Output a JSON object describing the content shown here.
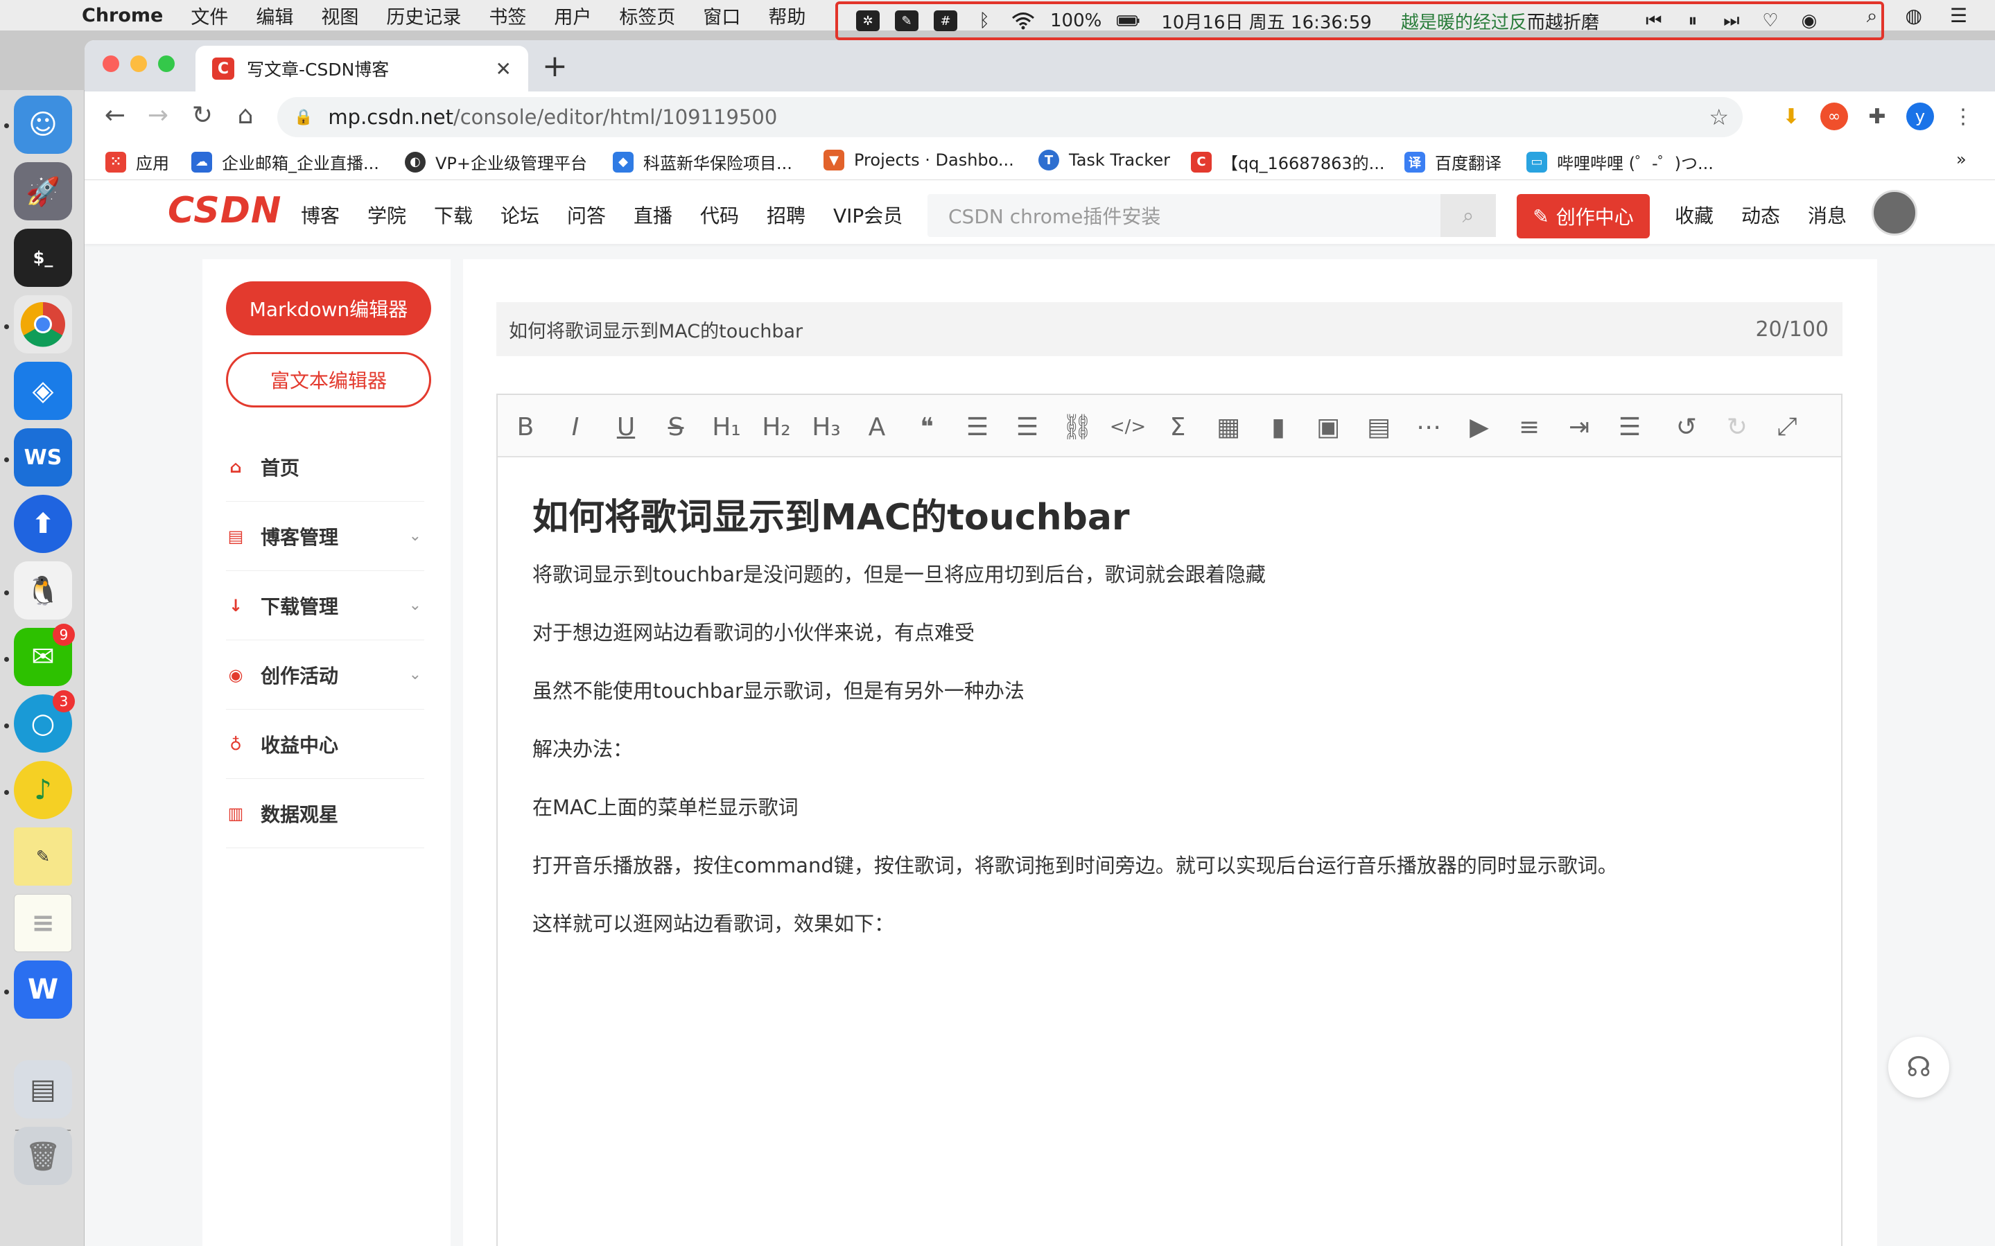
{
  "menubar": {
    "app_name": "Chrome",
    "items": [
      "文件",
      "编辑",
      "视图",
      "历史记录",
      "书签",
      "用户",
      "标签页",
      "窗口",
      "帮助"
    ],
    "battery": "100%",
    "datetime": "10月16日 周五  16:36:59",
    "lyric_highlight": "越是暖的经过反",
    "lyric_rest": "而越折磨"
  },
  "dock": {
    "wechat_badge": "9",
    "chat_badge": "3"
  },
  "browser": {
    "tab_title": "写文章-CSDN博客",
    "url_host": "mp.csdn.net",
    "url_path": "/console/editor/html/109119500",
    "profile_initial": "y",
    "bookmarks": [
      {
        "label": "应用",
        "color": "#e94235"
      },
      {
        "label": "企业邮箱_企业直播...",
        "color": "#2b6bd8"
      },
      {
        "label": "VP+企业级管理平台",
        "color": "#333333"
      },
      {
        "label": "科蓝新华保险项目...",
        "color": "#2f7be4"
      },
      {
        "label": "Projects · Dashbo...",
        "color": "#e2622b"
      },
      {
        "label": "Task Tracker",
        "color": "#2e6fd0"
      },
      {
        "label": "【qq_16687863的...",
        "color": "#e33a2e"
      },
      {
        "label": "百度翻译",
        "color": "#3b7ff3"
      },
      {
        "label": "哔哩哔哩 (゜-゜)つ...",
        "color": "#29a3e0"
      }
    ],
    "more": "»"
  },
  "csdn": {
    "logo": "CSDN",
    "nav": [
      "博客",
      "学院",
      "下载",
      "论坛",
      "问答",
      "直播",
      "代码",
      "招聘",
      "VIP会员"
    ],
    "search_placeholder": "CSDN chrome插件安装",
    "create_label": "创作中心",
    "right_links": [
      "收藏",
      "动态",
      "消息"
    ],
    "sidebar": {
      "markdown_label": "Markdown编辑器",
      "richtext_label": "富文本编辑器",
      "items": [
        {
          "label": "首页",
          "icon": "home-icon",
          "chevron": false
        },
        {
          "label": "博客管理",
          "icon": "blog-icon",
          "chevron": true
        },
        {
          "label": "下载管理",
          "icon": "download-icon",
          "chevron": true
        },
        {
          "label": "创作活动",
          "icon": "activity-icon",
          "chevron": true
        },
        {
          "label": "收益中心",
          "icon": "income-icon",
          "chevron": false
        },
        {
          "label": "数据观星",
          "icon": "chart-icon",
          "chevron": false
        }
      ]
    },
    "editor": {
      "title_value": "如何将歌词显示到MAC的touchbar",
      "title_count": "20/100",
      "toolbar": [
        {
          "name": "bold-icon",
          "glyph": "B"
        },
        {
          "name": "italic-icon",
          "glyph": "I"
        },
        {
          "name": "underline-icon",
          "glyph": "U"
        },
        {
          "name": "strikethrough-icon",
          "glyph": "S"
        },
        {
          "name": "heading1-icon",
          "glyph": "H₁"
        },
        {
          "name": "heading2-icon",
          "glyph": "H₂"
        },
        {
          "name": "heading3-icon",
          "glyph": "H₃"
        },
        {
          "name": "font-color-icon",
          "glyph": "A"
        },
        {
          "name": "quote-icon",
          "glyph": "❝"
        },
        {
          "name": "ordered-list-icon",
          "glyph": "☰"
        },
        {
          "name": "unordered-list-icon",
          "glyph": "☰"
        },
        {
          "name": "link-icon",
          "glyph": "⛓"
        },
        {
          "name": "code-icon",
          "glyph": "</>"
        },
        {
          "name": "formula-icon",
          "glyph": "Σ"
        },
        {
          "name": "table-icon",
          "glyph": "▦"
        },
        {
          "name": "chart-icon",
          "glyph": "▮"
        },
        {
          "name": "image-icon",
          "glyph": "▣"
        },
        {
          "name": "template-icon",
          "glyph": "▤"
        },
        {
          "name": "divider-icon",
          "glyph": "⋯"
        },
        {
          "name": "video-icon",
          "glyph": "▶"
        },
        {
          "name": "page-break-icon",
          "glyph": "≡"
        },
        {
          "name": "indent-icon",
          "glyph": "⇥"
        },
        {
          "name": "line-height-icon",
          "glyph": "☰"
        },
        {
          "name": "undo-icon",
          "glyph": "↺"
        },
        {
          "name": "redo-icon",
          "glyph": "↻"
        },
        {
          "name": "fullscreen-icon",
          "glyph": "⤢"
        }
      ],
      "heading": "如何将歌词显示到MAC的touchbar",
      "paragraphs": [
        "将歌词显示到touchbar是没问题的，但是一旦将应用切到后台，歌词就会跟着隐藏",
        "对于想边逛网站边看歌词的小伙伴来说，有点难受",
        "虽然不能使用touchbar显示歌词，但是有另外一种办法",
        "解决办法：",
        "在MAC上面的菜单栏显示歌词",
        "打开音乐播放器，按住command键，按住歌词，将歌词拖到时间旁边。就可以实现后台运行音乐播放器的同时显示歌词。",
        "这样就可以逛网站边看歌词，效果如下："
      ]
    }
  }
}
